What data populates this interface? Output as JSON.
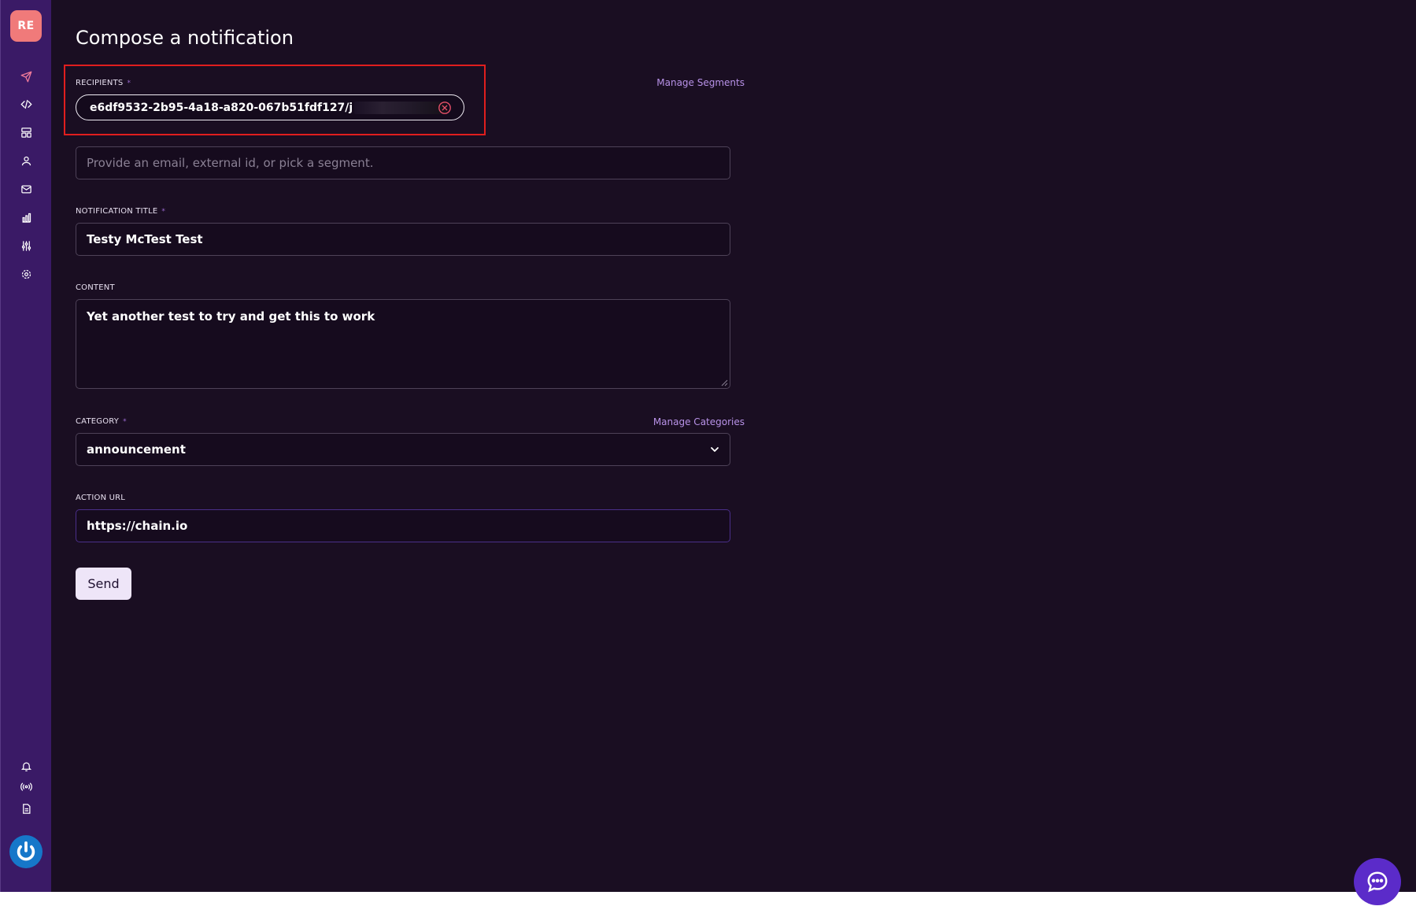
{
  "sidebar": {
    "workspace_badge": "RE",
    "nav": [
      {
        "icon": "send-icon",
        "label": "Compose"
      },
      {
        "icon": "code-icon",
        "label": "Developers"
      },
      {
        "icon": "layout-icon",
        "label": "Templates"
      },
      {
        "icon": "user-icon",
        "label": "Users"
      },
      {
        "icon": "mail-icon",
        "label": "Messages"
      },
      {
        "icon": "bar-chart-icon",
        "label": "Analytics"
      },
      {
        "icon": "sliders-icon",
        "label": "Preferences"
      },
      {
        "icon": "gear-icon",
        "label": "Settings"
      }
    ],
    "bottom": [
      {
        "icon": "bell-icon"
      },
      {
        "icon": "broadcast-icon"
      },
      {
        "icon": "document-icon"
      }
    ],
    "logo_icon": "power-logo-icon"
  },
  "page": {
    "title": "Compose a notification"
  },
  "form": {
    "recipients": {
      "label": "RECIPIENTS",
      "required_mark": "*",
      "manage_link": "Manage Segments",
      "chip_value": "e6df9532-2b95-4a18-a820-067b51fdf127/j",
      "placeholder": "Provide an email, external id, or pick a segment."
    },
    "title": {
      "label": "NOTIFICATION TITLE",
      "required_mark": "*",
      "value": "Testy McTest Test"
    },
    "content": {
      "label": "CONTENT",
      "value": "Yet another test to try and get this to work"
    },
    "category": {
      "label": "CATEGORY",
      "required_mark": "*",
      "manage_link": "Manage Categories",
      "value": "announcement"
    },
    "action_url": {
      "label": "ACTION URL",
      "value": "https://chain.io"
    },
    "send_label": "Send"
  },
  "colors": {
    "background": "#1a0e22",
    "sidebar": "#3a1a66",
    "accent": "#b892e8",
    "highlight": "#e01e1e",
    "send_button": "#eee5f8"
  }
}
